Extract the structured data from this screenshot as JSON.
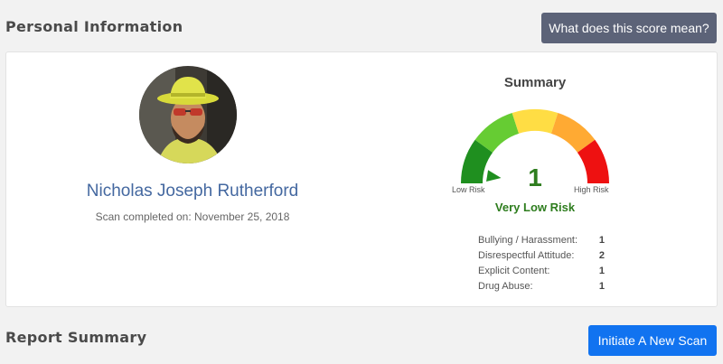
{
  "personal_info": {
    "title": "Personal Information"
  },
  "score_button": {
    "label": "What does this score mean?"
  },
  "profile": {
    "name": "Nicholas Joseph Rutherford",
    "scan_completed": "Scan completed on: November 25, 2018"
  },
  "summary": {
    "title": "Summary",
    "score": "1",
    "low_label": "Low Risk",
    "high_label": "High Risk",
    "risk_level": "Very Low Risk",
    "risk_fraction": 0.05,
    "gauge_colors": [
      "#1f8f1f",
      "#66cc33",
      "#ffdd44",
      "#ffaa33",
      "#ee1111"
    ],
    "items": [
      {
        "label": "Bullying / Harassment:",
        "value": "1"
      },
      {
        "label": "Disrespectful Attitude:",
        "value": "2"
      },
      {
        "label": "Explicit Content:",
        "value": "1"
      },
      {
        "label": "Drug Abuse:",
        "value": "1"
      }
    ]
  },
  "report_summary": {
    "title": "Report Summary"
  },
  "scan_button": {
    "label": "Initiate A New Scan"
  }
}
